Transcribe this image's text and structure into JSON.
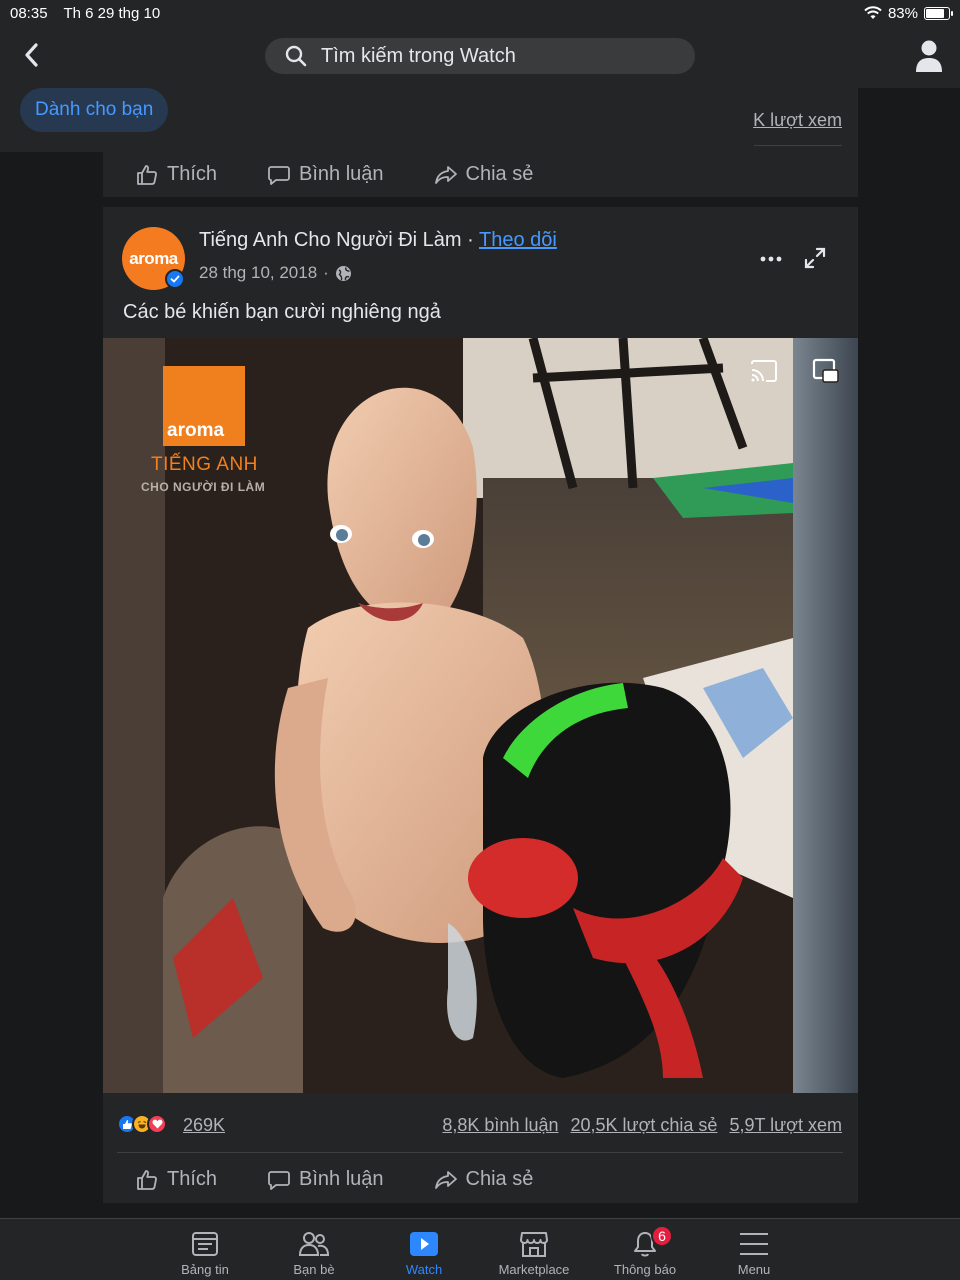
{
  "status_bar": {
    "time": "08:35",
    "date": "Th 6 29 thg 10",
    "battery": "83%",
    "battery_level": 0.83
  },
  "header": {
    "search_label": "Tìm kiếm trong Watch"
  },
  "filter": {
    "pill_label": "Dành cho bạn",
    "views_text": "K lượt xem"
  },
  "actions": {
    "like": "Thích",
    "comment": "Bình luận",
    "share": "Chia sẻ"
  },
  "post": {
    "author": "Tiếng Anh Cho Người Đi Làm",
    "separator": "·",
    "follow": "Theo dõi",
    "date": "28 thg 10, 2018",
    "meta_separator": "·",
    "caption": "Các bé khiến bạn cười nghiêng ngả",
    "avatar_text": "aroma",
    "video": {
      "watermark_brand": "aroma",
      "watermark_line1": "TIẾNG ANH",
      "watermark_line2": "CHO NGƯỜI ĐI LÀM"
    },
    "stats": {
      "reactions": "269K",
      "comments": "8,8K bình luận",
      "shares": "20,5K lượt chia sẻ",
      "views": "5,9T lượt xem"
    }
  },
  "tabs": [
    {
      "label": "Bảng tin",
      "icon": "news-feed-icon"
    },
    {
      "label": "Bạn bè",
      "icon": "friends-icon"
    },
    {
      "label": "Watch",
      "icon": "watch-icon",
      "active": true
    },
    {
      "label": "Marketplace",
      "icon": "marketplace-icon"
    },
    {
      "label": "Thông báo",
      "icon": "bell-icon",
      "badge": "6"
    },
    {
      "label": "Menu",
      "icon": "menu-icon"
    }
  ],
  "colors": {
    "accent": "#2d88ff",
    "link": "#4599ff",
    "badge": "#e41e3f",
    "brand_orange": "#f47b20"
  }
}
